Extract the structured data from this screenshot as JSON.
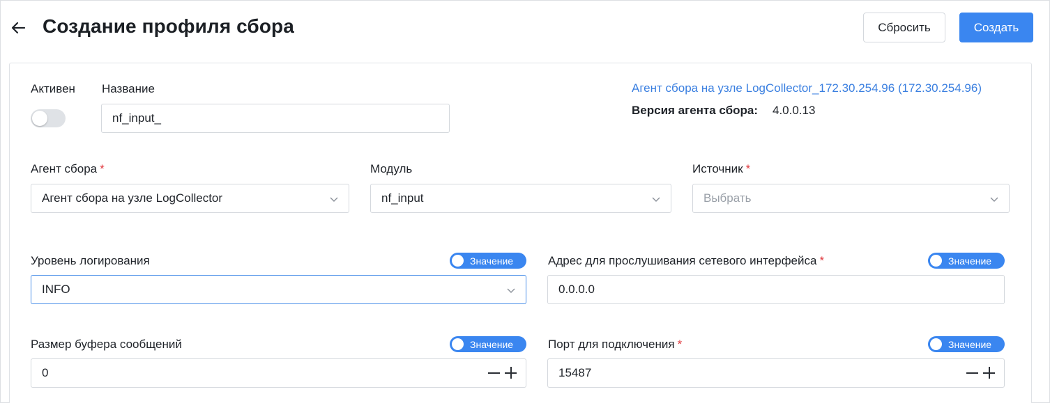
{
  "header": {
    "title": "Создание профиля сбора",
    "reset_label": "Сбросить",
    "create_label": "Создать"
  },
  "form": {
    "active_label": "Активен",
    "active_on": false,
    "name_label": "Название",
    "name_value": "nf_input_",
    "agent_link": "Агент сбора на узле LogCollector_172.30.254.96 (172.30.254.96)",
    "agent_version_label": "Версия агента сбора:",
    "agent_version_value": "4.0.0.13",
    "agent_label": "Агент сбора",
    "agent_value": "Агент сбора на узле LogCollector",
    "module_label": "Модуль",
    "module_value": "nf_input",
    "source_label": "Источник",
    "source_placeholder": "Выбрать",
    "required_mark": "*",
    "log_level_label": "Уровень логирования",
    "log_level_value": "INFO",
    "listen_address_label": "Адрес для прослушивания сетевого интерфейса",
    "listen_address_value": "0.0.0.0",
    "buffer_size_label": "Размер буфера сообщений",
    "buffer_size_value": "0",
    "port_label": "Порт для подключения",
    "port_value": "15487",
    "value_toggle_label": "Значение"
  },
  "colors": {
    "accent": "#3a86f0",
    "link": "#3a7fe0",
    "required": "#e0393e",
    "border": "#d4d8dd",
    "focus_border": "#4a8fe8"
  },
  "icons": {
    "back": "arrow-left-icon",
    "dropdown": "chevron-down-icon",
    "decrement": "minus-icon",
    "increment": "plus-icon"
  }
}
